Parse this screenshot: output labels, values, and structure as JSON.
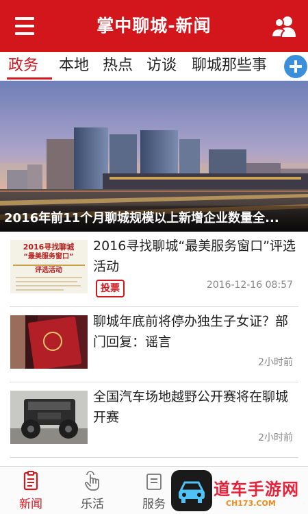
{
  "header": {
    "title": "掌中聊城-新闻",
    "menu_icon": "menu-icon",
    "user_icon": "user-icon"
  },
  "tabs": [
    {
      "label": "政务",
      "active": true
    },
    {
      "label": "本地",
      "active": false
    },
    {
      "label": "热点",
      "active": false
    },
    {
      "label": "访谈",
      "active": false
    },
    {
      "label": "聊城那些事",
      "active": false
    }
  ],
  "add_tab_icon": "plus-circle-icon",
  "banner": {
    "caption": "2016年前11个月聊城规模以上新增企业数量全..."
  },
  "news": [
    {
      "title": "2016寻找聊城“最美服务窗口”评选活动",
      "badge": "投票",
      "time": "2016-12-16 08:57",
      "thumb": {
        "line1": "2016寻找聊城",
        "line2": "“最美服务窗口”",
        "line3": "评选活动"
      }
    },
    {
      "title": "聊城年底前将停办独生子女证？部门回复：谣言",
      "time": "2小时前"
    },
    {
      "title": "全国汽车场地越野公开赛将在聊城开赛",
      "time": "2小时前"
    }
  ],
  "bottom_nav": [
    {
      "label": "新闻",
      "icon": "news-icon",
      "active": true
    },
    {
      "label": "乐活",
      "icon": "tap-icon",
      "active": false
    },
    {
      "label": "服务",
      "icon": "service-icon",
      "active": false
    }
  ],
  "watermark": {
    "text": "道车手游网",
    "url": "CH173.COM"
  },
  "colors": {
    "brand_red": "#d3151c",
    "accent_blue": "#3b8fd9"
  }
}
